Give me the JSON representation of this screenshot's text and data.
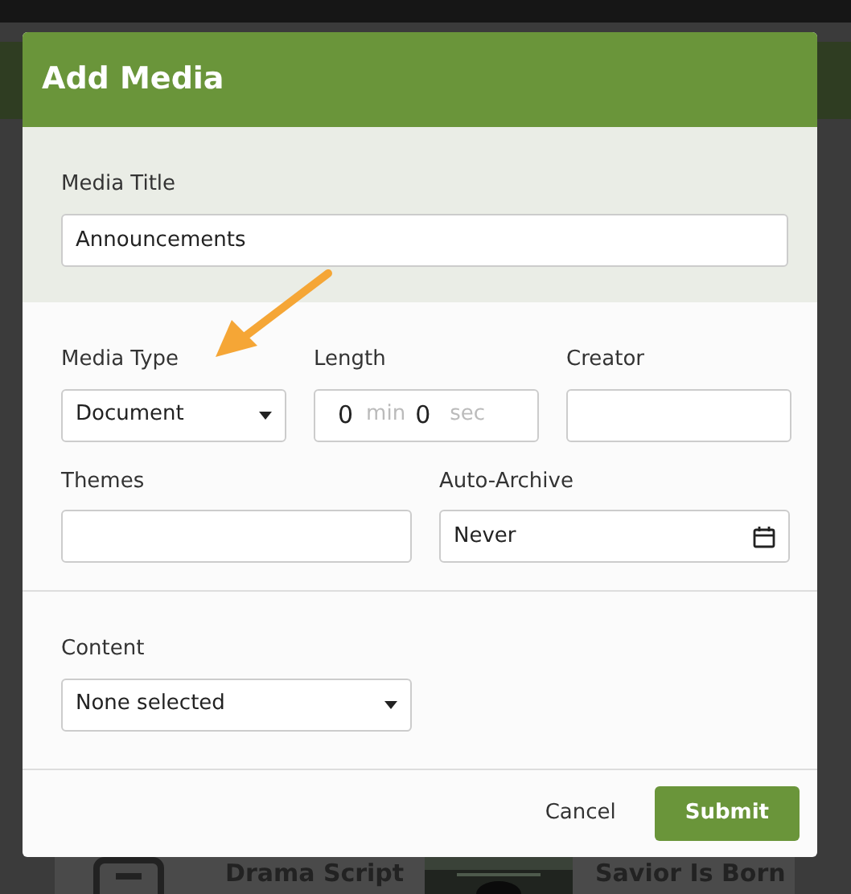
{
  "background": {
    "cards": [
      {
        "kind": "document",
        "title": "Drama Script"
      },
      {
        "kind": "picture",
        "title": "Savior Is Born"
      }
    ]
  },
  "dialog": {
    "title": "Add Media",
    "title_section": {
      "label": "Media Title",
      "value": "Announcements"
    },
    "rows": [
      [
        {
          "kind": "select",
          "label": "Media Type",
          "value": "Document"
        },
        {
          "kind": "duration",
          "label": "Length",
          "minutes": "0",
          "min_unit": "min",
          "seconds": "0",
          "sec_unit": "sec"
        },
        {
          "kind": "text",
          "label": "Creator"
        }
      ],
      [
        {
          "kind": "text",
          "label": "Themes"
        },
        {
          "kind": "date",
          "label": "Auto-Archive",
          "value": "Never"
        }
      ]
    ],
    "content": {
      "kind": "select",
      "label": "Content",
      "value": "None selected"
    },
    "buttons": [
      {
        "kind": "link",
        "label": "Cancel"
      },
      {
        "kind": "primary",
        "label": "Submit"
      }
    ]
  }
}
